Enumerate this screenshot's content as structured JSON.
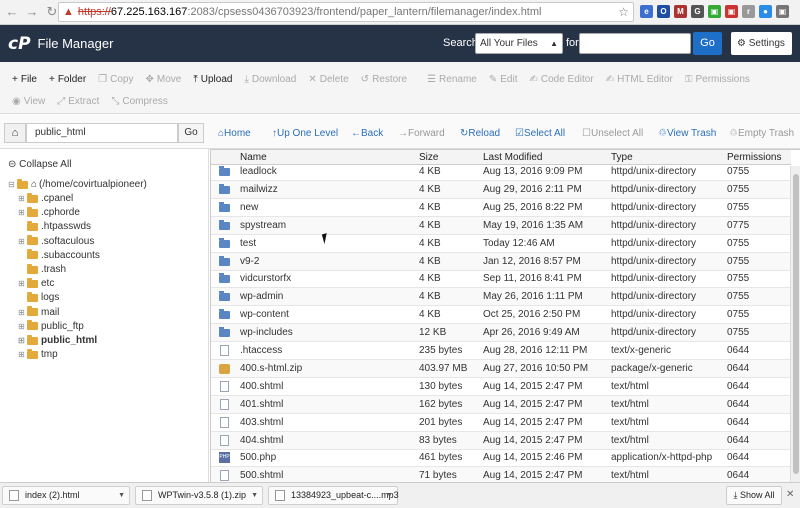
{
  "browser": {
    "url_protocol": "https://",
    "url_host": "67.225.163.167",
    "url_path": ":2083/cpsess0436703923/frontend/paper_lantern/filemanager/index.html",
    "extensions": [
      {
        "label": "e",
        "color": "#3b6fd0"
      },
      {
        "label": "O",
        "color": "#1e4ea1"
      },
      {
        "label": "M",
        "color": "#a33"
      },
      {
        "label": "G",
        "color": "#555"
      },
      {
        "label": "▣",
        "color": "#3a3"
      },
      {
        "label": "▣",
        "color": "#c33"
      },
      {
        "label": "r",
        "color": "#999"
      },
      {
        "label": "●",
        "color": "#2b8be6"
      },
      {
        "label": "▣",
        "color": "#777"
      }
    ]
  },
  "header": {
    "logo": "cP",
    "title": "File Manager",
    "search_label": "Search",
    "search_scope": "All Your Files",
    "for_label": "for",
    "go_label": "Go",
    "settings_label": "Settings"
  },
  "toolbar": {
    "row1": [
      {
        "icon": "+",
        "label": "File",
        "active": true
      },
      {
        "icon": "+",
        "label": "Folder",
        "active": true
      },
      {
        "icon": "❐",
        "label": "Copy",
        "active": false
      },
      {
        "icon": "✥",
        "label": "Move",
        "active": false
      },
      {
        "icon": "⤒",
        "label": "Upload",
        "active": true
      },
      {
        "icon": "⤓",
        "label": "Download",
        "active": false
      },
      {
        "icon": "✕",
        "label": "Delete",
        "active": false
      },
      {
        "icon": "↺",
        "label": "Restore",
        "active": false
      },
      {
        "icon": "☰",
        "label": "Rename",
        "active": false
      },
      {
        "icon": "✎",
        "label": "Edit",
        "active": false
      },
      {
        "icon": "✍",
        "label": "Code Editor",
        "active": false
      },
      {
        "icon": "✍",
        "label": "HTML Editor",
        "active": false
      },
      {
        "icon": "⚿",
        "label": "Permissions",
        "active": false
      }
    ],
    "row2": [
      {
        "icon": "◉",
        "label": "View",
        "active": false
      },
      {
        "icon": "⤢",
        "label": "Extract",
        "active": false
      },
      {
        "icon": "⤡",
        "label": "Compress",
        "active": false
      }
    ]
  },
  "pathbar": {
    "path_value": "public_html",
    "go_label": "Go",
    "nav": [
      {
        "icon": "⌂",
        "label": "Home",
        "enabled": true
      },
      {
        "icon": "↑",
        "label": "Up One Level",
        "enabled": true
      },
      {
        "icon": "←",
        "label": "Back",
        "enabled": true
      },
      {
        "icon": "→",
        "label": "Forward",
        "enabled": false
      },
      {
        "icon": "↻",
        "label": "Reload",
        "enabled": true
      },
      {
        "icon": "☑",
        "label": "Select All",
        "enabled": true
      },
      {
        "icon": "☐",
        "label": "Unselect All",
        "enabled": false
      },
      {
        "icon": "♲",
        "label": "View Trash",
        "enabled": true
      },
      {
        "icon": "♲",
        "label": "Empty Trash",
        "enabled": false
      }
    ]
  },
  "tree": {
    "collapse_all": "Collapse All",
    "root": "(/home/covirtualpioneer)",
    "items": [
      {
        "label": ".cpanel",
        "expandable": true,
        "bold": false
      },
      {
        "label": ".cphorde",
        "expandable": true,
        "bold": false
      },
      {
        "label": ".htpasswds",
        "expandable": false,
        "bold": false
      },
      {
        "label": ".softaculous",
        "expandable": true,
        "bold": false
      },
      {
        "label": ".subaccounts",
        "expandable": false,
        "bold": false
      },
      {
        "label": ".trash",
        "expandable": false,
        "bold": false
      },
      {
        "label": "etc",
        "expandable": true,
        "bold": false
      },
      {
        "label": "logs",
        "expandable": false,
        "bold": false
      },
      {
        "label": "mail",
        "expandable": true,
        "bold": false
      },
      {
        "label": "public_ftp",
        "expandable": true,
        "bold": false
      },
      {
        "label": "public_html",
        "expandable": true,
        "bold": true
      },
      {
        "label": "tmp",
        "expandable": true,
        "bold": false
      }
    ]
  },
  "table": {
    "columns": [
      "Name",
      "Size",
      "Last Modified",
      "Type",
      "Permissions"
    ],
    "rows": [
      {
        "icon": "folder",
        "name": "leadlock",
        "size": "4 KB",
        "modified": "Aug 13, 2016 9:09 PM",
        "type": "httpd/unix-directory",
        "perms": "0755"
      },
      {
        "icon": "folder",
        "name": "mailwizz",
        "size": "4 KB",
        "modified": "Aug 29, 2016 2:11 PM",
        "type": "httpd/unix-directory",
        "perms": "0755"
      },
      {
        "icon": "folder",
        "name": "new",
        "size": "4 KB",
        "modified": "Aug 25, 2016 8:22 PM",
        "type": "httpd/unix-directory",
        "perms": "0755"
      },
      {
        "icon": "folder",
        "name": "spystream",
        "size": "4 KB",
        "modified": "May 19, 2016 1:35 AM",
        "type": "httpd/unix-directory",
        "perms": "0775"
      },
      {
        "icon": "folder",
        "name": "test",
        "size": "4 KB",
        "modified": "Today 12:46 AM",
        "type": "httpd/unix-directory",
        "perms": "0755"
      },
      {
        "icon": "folder",
        "name": "v9-2",
        "size": "4 KB",
        "modified": "Jan 12, 2016 8:57 PM",
        "type": "httpd/unix-directory",
        "perms": "0755"
      },
      {
        "icon": "folder",
        "name": "vidcurstorfx",
        "size": "4 KB",
        "modified": "Sep 11, 2016 8:41 PM",
        "type": "httpd/unix-directory",
        "perms": "0755"
      },
      {
        "icon": "folder",
        "name": "wp-admin",
        "size": "4 KB",
        "modified": "May 26, 2016 1:11 PM",
        "type": "httpd/unix-directory",
        "perms": "0755"
      },
      {
        "icon": "folder",
        "name": "wp-content",
        "size": "4 KB",
        "modified": "Oct 25, 2016 2:50 PM",
        "type": "httpd/unix-directory",
        "perms": "0755"
      },
      {
        "icon": "folder",
        "name": "wp-includes",
        "size": "12 KB",
        "modified": "Apr 26, 2016 9:49 AM",
        "type": "httpd/unix-directory",
        "perms": "0755"
      },
      {
        "icon": "file",
        "name": ".htaccess",
        "size": "235 bytes",
        "modified": "Aug 28, 2016 12:11 PM",
        "type": "text/x-generic",
        "perms": "0644"
      },
      {
        "icon": "zip",
        "name": "400.s-html.zip",
        "size": "403.97 MB",
        "modified": "Aug 27, 2016 10:50 PM",
        "type": "package/x-generic",
        "perms": "0644"
      },
      {
        "icon": "file",
        "name": "400.shtml",
        "size": "130 bytes",
        "modified": "Aug 14, 2015 2:47 PM",
        "type": "text/html",
        "perms": "0644"
      },
      {
        "icon": "file",
        "name": "401.shtml",
        "size": "162 bytes",
        "modified": "Aug 14, 2015 2:47 PM",
        "type": "text/html",
        "perms": "0644"
      },
      {
        "icon": "file",
        "name": "403.shtml",
        "size": "201 bytes",
        "modified": "Aug 14, 2015 2:47 PM",
        "type": "text/html",
        "perms": "0644"
      },
      {
        "icon": "file",
        "name": "404.shtml",
        "size": "83 bytes",
        "modified": "Aug 14, 2015 2:47 PM",
        "type": "text/html",
        "perms": "0644"
      },
      {
        "icon": "php",
        "name": "500.php",
        "size": "461 bytes",
        "modified": "Aug 14, 2015 2:46 PM",
        "type": "application/x-httpd-php",
        "perms": "0644"
      },
      {
        "icon": "file",
        "name": "500.shtml",
        "size": "71 bytes",
        "modified": "Aug 14, 2015 2:47 PM",
        "type": "text/html",
        "perms": "0644"
      }
    ]
  },
  "downloads": {
    "items": [
      "index (2).html",
      "WPTwin-v3.5.8 (1).zip",
      "13384923_upbeat-c....mp3"
    ],
    "show_all": "Show All"
  }
}
